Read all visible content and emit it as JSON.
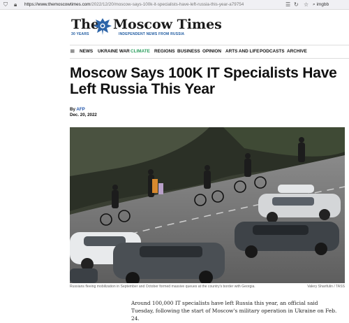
{
  "browser": {
    "url_host": "https://www.themoscowtimes.com",
    "url_path": "/2022/12/20/moscow-says-100k-it-specialists-have-left-russia-this-year-a79754",
    "search_text": "imgbb"
  },
  "header": {
    "logo_the": "The",
    "logo_name": "Moscow Times",
    "logo_years": "30 YEARS",
    "tagline": "INDEPENDENT NEWS FROM RUSSIA"
  },
  "nav": {
    "items": [
      "NEWS",
      "UKRAINE WAR",
      "CLIMATE",
      "REGIONS",
      "BUSINESS",
      "OPINION",
      "ARTS AND LIFE",
      "PODCASTS",
      "ARCHIVE"
    ],
    "active_color": "#2a9d5c"
  },
  "article": {
    "headline": "Moscow Says 100K IT Specialists Have Left Russia This Year",
    "by_prefix": "By",
    "author": "AFP",
    "date": "Dec. 20, 2022",
    "caption": "Russians fleeing mobilization in September and October formed massive queues at the country's border with Georgia.",
    "credit": "Valery Sharifulin / TASS",
    "body": "Around 100,000 IT specialists have left Russia this year, an official said Tuesday, following the start of Moscow's military operation in Ukraine on Feb. 24."
  }
}
